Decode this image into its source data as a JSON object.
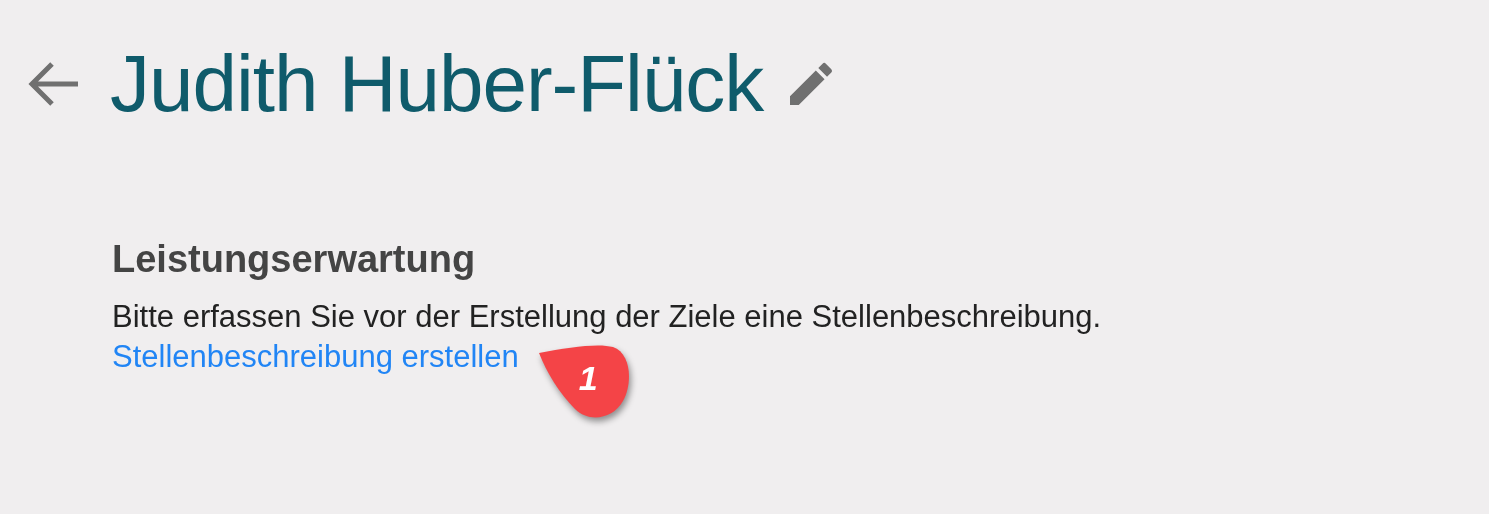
{
  "header": {
    "title": "Judith Huber-Flück"
  },
  "section": {
    "heading": "Leistungserwartung",
    "text": "Bitte erfassen Sie vor der Erstellung der Ziele eine Stellenbeschreibung.",
    "link": "Stellenbeschreibung erstellen"
  },
  "callout": {
    "label": "1"
  }
}
